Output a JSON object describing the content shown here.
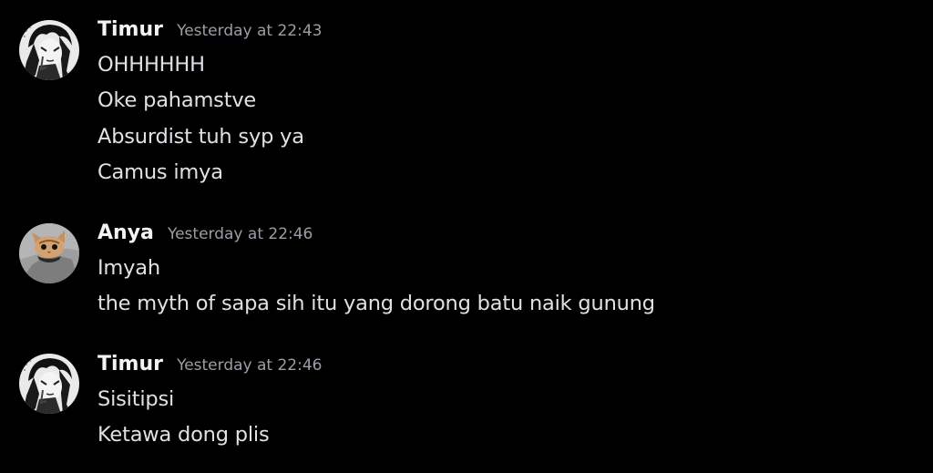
{
  "groups": [
    {
      "author": "Timur",
      "avatar_icon": "manga-avatar-icon",
      "timestamp": "Yesterday at 22:43",
      "messages": [
        "OHHHHHH",
        "Oke pahamstve",
        "Absurdist tuh syp ya",
        "Camus imya"
      ]
    },
    {
      "author": "Anya",
      "avatar_icon": "cat-avatar-icon",
      "timestamp": "Yesterday at 22:46",
      "messages": [
        "Imyah",
        "the myth of sapa sih itu yang dorong batu naik gunung"
      ]
    },
    {
      "author": "Timur",
      "avatar_icon": "manga-avatar-icon",
      "timestamp": "Yesterday at 22:46",
      "messages": [
        "Sisitipsi",
        "Ketawa dong plis"
      ]
    }
  ],
  "colors": {
    "background": "#000000",
    "username": "#f2f3f5",
    "timestamp": "#9b9ea6",
    "message_text": "#dfe1e5"
  }
}
